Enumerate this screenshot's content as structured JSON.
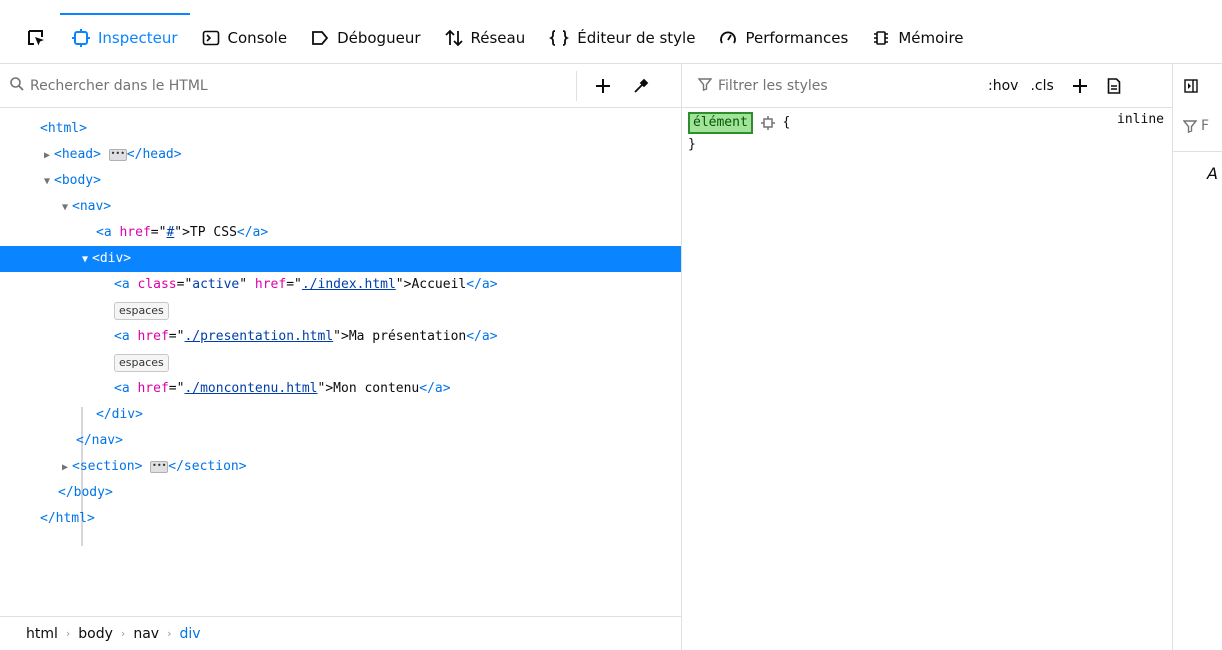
{
  "toolbar": {
    "tabs": [
      {
        "label": "Inspecteur",
        "icon": "inspector-icon",
        "selected": true
      },
      {
        "label": "Console",
        "icon": "console-icon",
        "selected": false
      },
      {
        "label": "Débogueur",
        "icon": "debugger-icon",
        "selected": false
      },
      {
        "label": "Réseau",
        "icon": "network-icon",
        "selected": false
      },
      {
        "label": "Éditeur de style",
        "icon": "style-editor-icon",
        "selected": false
      },
      {
        "label": "Performances",
        "icon": "performance-icon",
        "selected": false
      },
      {
        "label": "Mémoire",
        "icon": "memory-icon",
        "selected": false
      }
    ]
  },
  "markup": {
    "search_placeholder": "Rechercher dans le HTML",
    "tree": {
      "html_open": "<html>",
      "head_open": "<head>",
      "head_close": "</head>",
      "body_open": "<body>",
      "nav_open": "<nav>",
      "a1_open": "<a",
      "a1_attr": "href",
      "a1_val": "#",
      "a1_text": ">TP CSS",
      "a_close": "</a>",
      "div_open": "<div>",
      "accueil_class_attr": "class",
      "accueil_class_val": "active",
      "accueil_href_val": "./index.html",
      "accueil_text": ">Accueil",
      "whitespace_badge": "espaces",
      "presentation_href_val": "./presentation.html",
      "presentation_text": ">Ma présentation",
      "contenu_href_val": "./moncontenu.html",
      "contenu_text": ">Mon contenu",
      "div_close": "</div>",
      "nav_close": "</nav>",
      "section_open": "<section>",
      "section_close": "</section>",
      "body_close": "</body>",
      "html_close": "</html>"
    },
    "breadcrumbs": [
      "html",
      "body",
      "nav",
      "div"
    ]
  },
  "rules": {
    "filter_placeholder": "Filtrer les styles",
    "hov_label": ":hov",
    "cls_label": ".cls",
    "selector": "élément",
    "open_brace": "{",
    "close_brace": "}",
    "source": "inline"
  },
  "side": {
    "letter": "A"
  }
}
